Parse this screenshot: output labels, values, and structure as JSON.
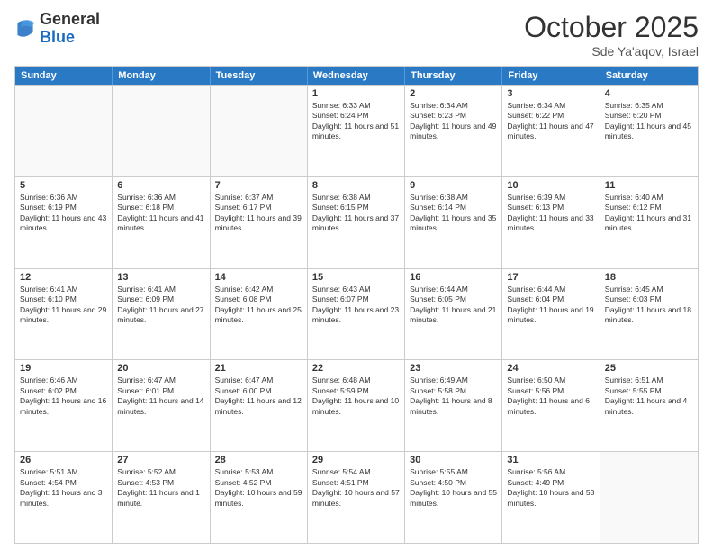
{
  "logo": {
    "general": "General",
    "blue": "Blue"
  },
  "title": {
    "month": "October 2025",
    "location": "Sde Ya'aqov, Israel"
  },
  "header_days": [
    "Sunday",
    "Monday",
    "Tuesday",
    "Wednesday",
    "Thursday",
    "Friday",
    "Saturday"
  ],
  "rows": [
    [
      {
        "day": "",
        "empty": true
      },
      {
        "day": "",
        "empty": true
      },
      {
        "day": "",
        "empty": true
      },
      {
        "day": "1",
        "rise": "6:33 AM",
        "set": "6:24 PM",
        "daylight": "11 hours and 51 minutes."
      },
      {
        "day": "2",
        "rise": "6:34 AM",
        "set": "6:23 PM",
        "daylight": "11 hours and 49 minutes."
      },
      {
        "day": "3",
        "rise": "6:34 AM",
        "set": "6:22 PM",
        "daylight": "11 hours and 47 minutes."
      },
      {
        "day": "4",
        "rise": "6:35 AM",
        "set": "6:20 PM",
        "daylight": "11 hours and 45 minutes."
      }
    ],
    [
      {
        "day": "5",
        "rise": "6:36 AM",
        "set": "6:19 PM",
        "daylight": "11 hours and 43 minutes."
      },
      {
        "day": "6",
        "rise": "6:36 AM",
        "set": "6:18 PM",
        "daylight": "11 hours and 41 minutes."
      },
      {
        "day": "7",
        "rise": "6:37 AM",
        "set": "6:17 PM",
        "daylight": "11 hours and 39 minutes."
      },
      {
        "day": "8",
        "rise": "6:38 AM",
        "set": "6:15 PM",
        "daylight": "11 hours and 37 minutes."
      },
      {
        "day": "9",
        "rise": "6:38 AM",
        "set": "6:14 PM",
        "daylight": "11 hours and 35 minutes."
      },
      {
        "day": "10",
        "rise": "6:39 AM",
        "set": "6:13 PM",
        "daylight": "11 hours and 33 minutes."
      },
      {
        "day": "11",
        "rise": "6:40 AM",
        "set": "6:12 PM",
        "daylight": "11 hours and 31 minutes."
      }
    ],
    [
      {
        "day": "12",
        "rise": "6:41 AM",
        "set": "6:10 PM",
        "daylight": "11 hours and 29 minutes."
      },
      {
        "day": "13",
        "rise": "6:41 AM",
        "set": "6:09 PM",
        "daylight": "11 hours and 27 minutes."
      },
      {
        "day": "14",
        "rise": "6:42 AM",
        "set": "6:08 PM",
        "daylight": "11 hours and 25 minutes."
      },
      {
        "day": "15",
        "rise": "6:43 AM",
        "set": "6:07 PM",
        "daylight": "11 hours and 23 minutes."
      },
      {
        "day": "16",
        "rise": "6:44 AM",
        "set": "6:05 PM",
        "daylight": "11 hours and 21 minutes."
      },
      {
        "day": "17",
        "rise": "6:44 AM",
        "set": "6:04 PM",
        "daylight": "11 hours and 19 minutes."
      },
      {
        "day": "18",
        "rise": "6:45 AM",
        "set": "6:03 PM",
        "daylight": "11 hours and 18 minutes."
      }
    ],
    [
      {
        "day": "19",
        "rise": "6:46 AM",
        "set": "6:02 PM",
        "daylight": "11 hours and 16 minutes."
      },
      {
        "day": "20",
        "rise": "6:47 AM",
        "set": "6:01 PM",
        "daylight": "11 hours and 14 minutes."
      },
      {
        "day": "21",
        "rise": "6:47 AM",
        "set": "6:00 PM",
        "daylight": "11 hours and 12 minutes."
      },
      {
        "day": "22",
        "rise": "6:48 AM",
        "set": "5:59 PM",
        "daylight": "11 hours and 10 minutes."
      },
      {
        "day": "23",
        "rise": "6:49 AM",
        "set": "5:58 PM",
        "daylight": "11 hours and 8 minutes."
      },
      {
        "day": "24",
        "rise": "6:50 AM",
        "set": "5:56 PM",
        "daylight": "11 hours and 6 minutes."
      },
      {
        "day": "25",
        "rise": "6:51 AM",
        "set": "5:55 PM",
        "daylight": "11 hours and 4 minutes."
      }
    ],
    [
      {
        "day": "26",
        "rise": "5:51 AM",
        "set": "4:54 PM",
        "daylight": "11 hours and 3 minutes."
      },
      {
        "day": "27",
        "rise": "5:52 AM",
        "set": "4:53 PM",
        "daylight": "11 hours and 1 minute."
      },
      {
        "day": "28",
        "rise": "5:53 AM",
        "set": "4:52 PM",
        "daylight": "10 hours and 59 minutes."
      },
      {
        "day": "29",
        "rise": "5:54 AM",
        "set": "4:51 PM",
        "daylight": "10 hours and 57 minutes."
      },
      {
        "day": "30",
        "rise": "5:55 AM",
        "set": "4:50 PM",
        "daylight": "10 hours and 55 minutes."
      },
      {
        "day": "31",
        "rise": "5:56 AM",
        "set": "4:49 PM",
        "daylight": "10 hours and 53 minutes."
      },
      {
        "day": "",
        "empty": true
      }
    ]
  ]
}
